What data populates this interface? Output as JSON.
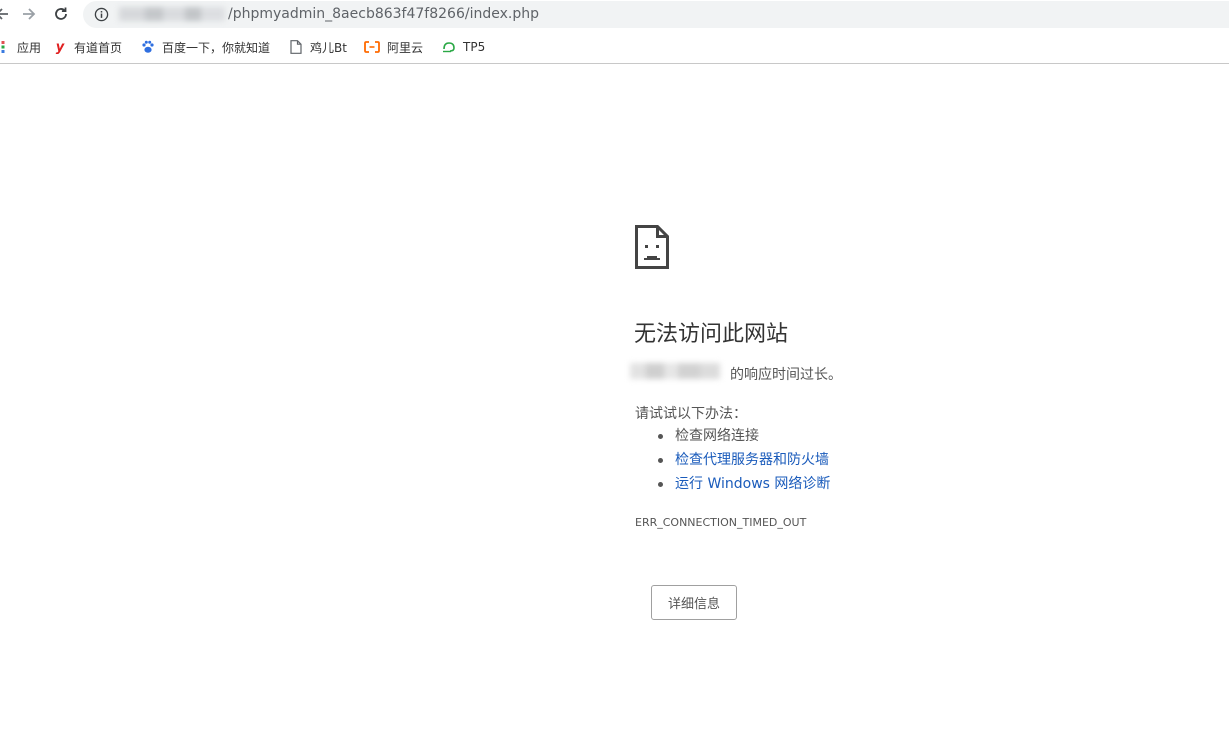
{
  "browser": {
    "url_path": "/phpmyadmin_8aecb863f47f8266/index.php",
    "back_icon": "back-arrow-icon",
    "forward_icon": "forward-arrow-icon",
    "reload_icon": "reload-icon",
    "site_info_icon": "info-icon"
  },
  "bookmarks": {
    "items": [
      {
        "label": "应用",
        "icon": "apps-grid-icon",
        "color": "#e0a000"
      },
      {
        "label": "有道首页",
        "icon": "youdao-y-icon",
        "color": "#e02020"
      },
      {
        "label": "百度一下，你就知道",
        "icon": "baidu-paw-icon",
        "color": "#2f6fe0"
      },
      {
        "label": "鸡儿Bt",
        "icon": "page-icon",
        "color": "#5f6368"
      },
      {
        "label": "阿里云",
        "icon": "aliyun-icon",
        "color": "#ff6a00"
      },
      {
        "label": "TP5",
        "icon": "tp5-icon",
        "color": "#2aa845"
      }
    ]
  },
  "error_page": {
    "icon": "sad-page-icon",
    "title": "无法访问此网站",
    "description_suffix": "的响应时间过长。",
    "try_label": "请试试以下办法：",
    "suggestions": [
      {
        "text": "检查网络连接",
        "is_link": false
      },
      {
        "text": "检查代理服务器和防火墙",
        "is_link": true
      },
      {
        "text": "运行 Windows 网络诊断",
        "is_link": true
      }
    ],
    "error_code": "ERR_CONNECTION_TIMED_OUT",
    "details_button": "详细信息"
  },
  "colors": {
    "link": "#1a5bbb",
    "text": "#555555",
    "title": "#333333",
    "omnibox_bg": "#f1f3f4"
  }
}
